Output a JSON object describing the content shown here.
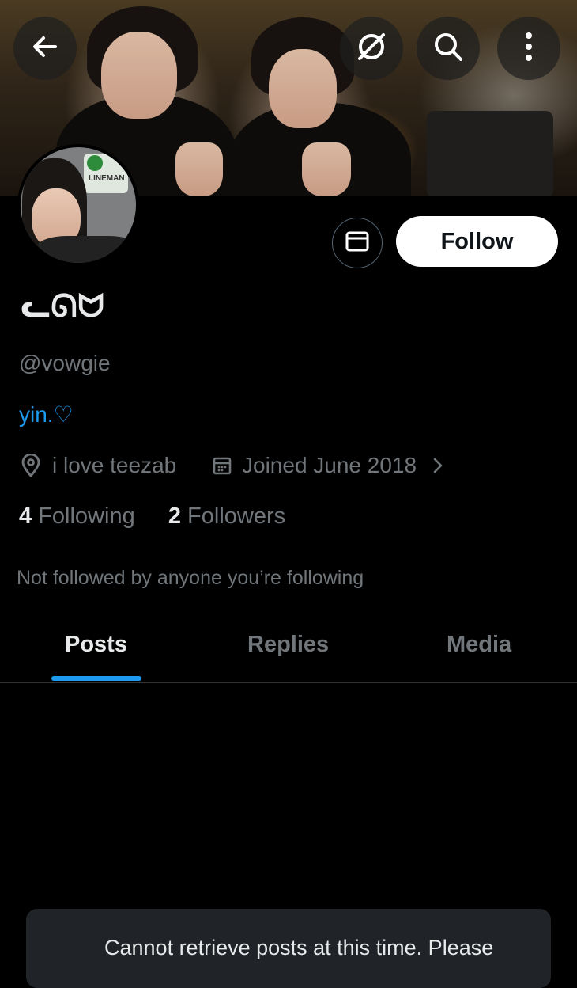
{
  "header": {
    "back_icon": "arrow-left-icon",
    "grok_icon": "grok-icon",
    "search_icon": "search-icon",
    "more_icon": "more-vertical-icon"
  },
  "profile": {
    "display_name": "ᓚᘏᗢ",
    "handle": "@vowgie",
    "bio": "yin.♡",
    "location": "i love teezab",
    "joined": "Joined June 2018",
    "following_count": "4",
    "following_label": "Following",
    "followers_count": "2",
    "followers_label": "Followers",
    "not_followed": "Not followed by anyone you’re following",
    "avatar_sign": "LINEMAN"
  },
  "actions": {
    "follow_label": "Follow",
    "message_icon": "mail-icon"
  },
  "tabs": [
    {
      "label": "Posts",
      "active": true
    },
    {
      "label": "Replies",
      "active": false
    },
    {
      "label": "Media",
      "active": false
    }
  ],
  "toast": {
    "message": "Cannot retrieve posts at this time. Please"
  },
  "colors": {
    "accent": "#1d9bf0",
    "muted": "#71767b",
    "text": "#e7e9ea",
    "background": "#000000"
  }
}
